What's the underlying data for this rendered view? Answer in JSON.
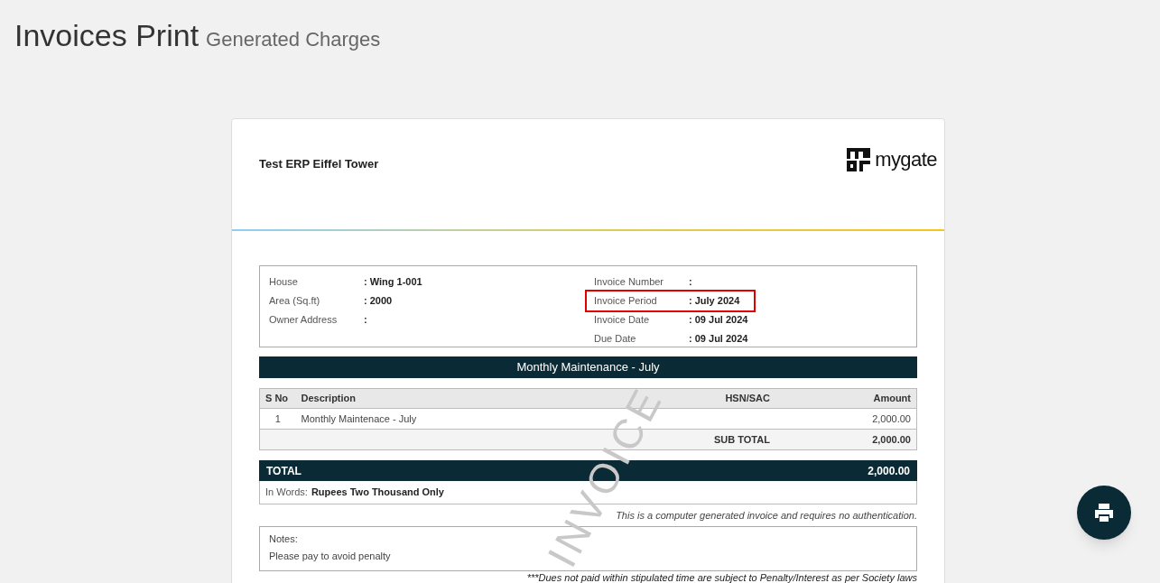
{
  "page": {
    "title": "Invoices Print",
    "subtitle": "Generated Charges"
  },
  "invoice": {
    "society": "Test ERP Eiffel Tower",
    "logo_text": "mygate",
    "watermark": "INVOICE",
    "left_fields": [
      {
        "label": "House",
        "value": ": Wing 1-001",
        "highlighted": false
      },
      {
        "label": "Area (Sq.ft)",
        "value": ": 2000",
        "highlighted": false
      },
      {
        "label": "Owner Address",
        "value": ":",
        "highlighted": false
      }
    ],
    "right_fields": [
      {
        "label": "Invoice Number",
        "value": ":",
        "highlighted": false
      },
      {
        "label": "Invoice Period",
        "value": ": July 2024",
        "highlighted": true
      },
      {
        "label": "Invoice Date",
        "value": ": 09 Jul 2024",
        "highlighted": false
      },
      {
        "label": "Due Date",
        "value": ": 09 Jul 2024",
        "highlighted": false
      }
    ],
    "section_title": "Monthly Maintenance - July",
    "columns": [
      "S No",
      "Description",
      "HSN/SAC",
      "Amount"
    ],
    "rows": [
      {
        "sno": "1",
        "description": "Monthly Maintenace - July",
        "hsn": "",
        "amount": "2,000.00"
      }
    ],
    "subtotal_label": "SUB TOTAL",
    "subtotal": "2,000.00",
    "total_label": "TOTAL",
    "total": "2,000.00",
    "in_words_label": "In Words:",
    "in_words": "Rupees Two Thousand Only",
    "disclaimer": "This is a computer generated invoice and requires no authentication.",
    "notes_label": "Notes:",
    "notes": "Please pay to avoid penalty",
    "footer_note": "***Dues not paid within stipulated time are subject to Penalty/Interest as per Society laws"
  }
}
